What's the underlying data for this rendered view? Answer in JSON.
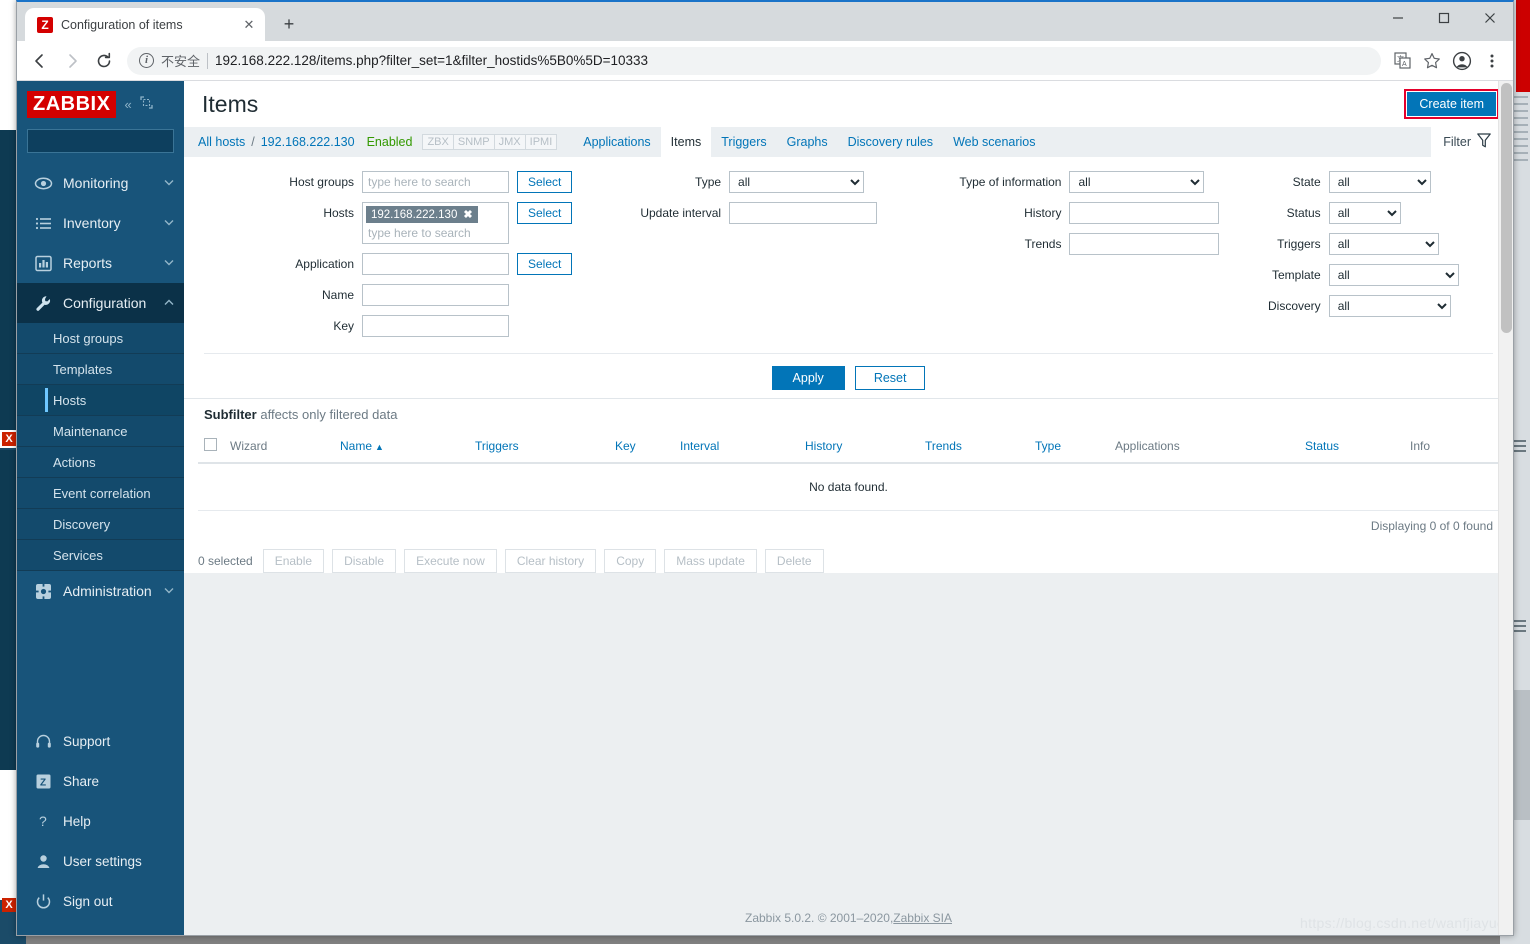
{
  "browser": {
    "tab": {
      "title": "Configuration of items",
      "favicon_letter": "Z",
      "close_label": "✕"
    },
    "new_tab_label": "+",
    "window_controls": {
      "minimize": "─",
      "maximize": "☐",
      "close": "✕"
    },
    "nav": {
      "back": "←",
      "forward": "→",
      "reload": "⟳"
    },
    "omnibox": {
      "security_text": "不安全",
      "url": "192.168.222.128/items.php?filter_set=1&filter_hostids%5B0%5D=10333",
      "translate_icon": "translate-icon",
      "bookmark_icon": "star-icon",
      "profile_icon": "profile-icon",
      "menu_icon": "kebab-menu-icon"
    }
  },
  "sidebar": {
    "brand": "ZABBIX",
    "collapse_label": "«",
    "expand_label": "⤡",
    "search_placeholder": "",
    "search_value": "",
    "search_icon": "search-icon",
    "items": [
      {
        "label": "Monitoring",
        "icon": "eye-icon",
        "caret": "ⱟ"
      },
      {
        "label": "Inventory",
        "icon": "list-icon",
        "caret": "ⱟ"
      },
      {
        "label": "Reports",
        "icon": "bar-chart-icon",
        "caret": "ⱟ"
      },
      {
        "label": "Configuration",
        "icon": "wrench-icon",
        "caret": "ⱞ"
      }
    ],
    "submenu": [
      {
        "label": "Host groups"
      },
      {
        "label": "Templates"
      },
      {
        "label": "Hosts"
      },
      {
        "label": "Maintenance"
      },
      {
        "label": "Actions"
      },
      {
        "label": "Event correlation"
      },
      {
        "label": "Discovery"
      },
      {
        "label": "Services"
      }
    ],
    "administration": {
      "label": "Administration",
      "icon": "gear-icon",
      "caret": "ⱟ"
    },
    "bottom_items": [
      {
        "label": "Support",
        "icon": "headset-icon"
      },
      {
        "label": "Share",
        "icon": "zabbix-share-icon"
      },
      {
        "label": "Help",
        "icon": "question-icon"
      },
      {
        "label": "User settings",
        "icon": "user-icon"
      },
      {
        "label": "Sign out",
        "icon": "power-icon"
      }
    ]
  },
  "header": {
    "title": "Items",
    "create_button": "Create item"
  },
  "breadcrumb": {
    "all_hosts": "All hosts",
    "separator": "/",
    "host": "192.168.222.130",
    "status": "Enabled",
    "protocols": [
      "ZBX",
      "SNMP",
      "JMX",
      "IPMI"
    ],
    "tabs": [
      {
        "label": "Applications",
        "selected": false
      },
      {
        "label": "Items",
        "selected": true
      },
      {
        "label": "Triggers",
        "selected": false
      },
      {
        "label": "Graphs",
        "selected": false
      },
      {
        "label": "Discovery rules",
        "selected": false
      },
      {
        "label": "Web scenarios",
        "selected": false
      }
    ],
    "filter_tab": {
      "label": "Filter",
      "icon": "funnel-icon"
    }
  },
  "filter": {
    "host_groups": {
      "label": "Host groups",
      "placeholder": "type here to search",
      "value": "",
      "select_button": "Select"
    },
    "hosts": {
      "label": "Hosts",
      "chip": "192.168.222.130",
      "chip_remove": "✖",
      "placeholder": "type here to search",
      "select_button": "Select"
    },
    "application": {
      "label": "Application",
      "value": "",
      "select_button": "Select"
    },
    "name": {
      "label": "Name",
      "value": ""
    },
    "key": {
      "label": "Key",
      "value": ""
    },
    "type": {
      "label": "Type",
      "value": "all"
    },
    "update_interval": {
      "label": "Update interval",
      "value": ""
    },
    "type_of_information": {
      "label": "Type of information",
      "value": "all"
    },
    "history": {
      "label": "History",
      "value": ""
    },
    "trends": {
      "label": "Trends",
      "value": ""
    },
    "state": {
      "label": "State",
      "value": "all"
    },
    "status": {
      "label": "Status",
      "value": "all"
    },
    "triggers": {
      "label": "Triggers",
      "value": "all"
    },
    "template": {
      "label": "Template",
      "value": "all"
    },
    "discovery": {
      "label": "Discovery",
      "value": "all"
    },
    "apply_button": "Apply",
    "reset_button": "Reset"
  },
  "subfilter": {
    "title": "Subfilter",
    "hint": "affects only filtered data"
  },
  "table": {
    "columns": [
      {
        "label": "Wizard",
        "sortable": false
      },
      {
        "label": "Name",
        "sortable": true,
        "sort_arrow": "▲"
      },
      {
        "label": "Triggers",
        "sortable": true
      },
      {
        "label": "Key",
        "sortable": true
      },
      {
        "label": "Interval",
        "sortable": true
      },
      {
        "label": "History",
        "sortable": true
      },
      {
        "label": "Trends",
        "sortable": true
      },
      {
        "label": "Type",
        "sortable": true
      },
      {
        "label": "Applications",
        "sortable": false
      },
      {
        "label": "Status",
        "sortable": true
      },
      {
        "label": "Info",
        "sortable": false
      }
    ],
    "empty_message": "No data found.",
    "displaying": "Displaying 0 of 0 found"
  },
  "actions": {
    "selected_count": "0 selected",
    "buttons": [
      "Enable",
      "Disable",
      "Execute now",
      "Clear history",
      "Copy",
      "Mass update",
      "Delete"
    ]
  },
  "footer": {
    "text": "Zabbix 5.0.2. © 2001–2020, ",
    "link": "Zabbix SIA",
    "watermark": "https://blog.csdn.net/wanfjiayue"
  }
}
